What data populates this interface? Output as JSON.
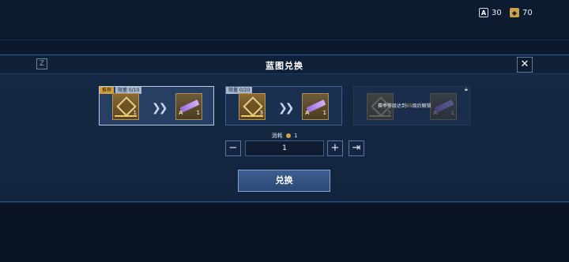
{
  "topbar": {
    "currency_a_value": "30",
    "currency_b_value": "70",
    "currency_a_icon": "a-token-icon",
    "currency_b_icon": "gold-crate-icon"
  },
  "modal": {
    "title": "蓝图兑换",
    "close_icon": "close-icon"
  },
  "options": [
    {
      "recommend_tag": "推荐",
      "limit_tag": "限量 0/10",
      "source_qty": "1",
      "target_grade": "A",
      "target_qty": "1"
    },
    {
      "limit_tag": "限量 0/20",
      "source_qty": "3",
      "target_grade": "A",
      "target_qty": "1"
    },
    {
      "source_qty": "5",
      "target_grade": "A",
      "target_qty": "1",
      "lock_prefix": "赛季等级达到",
      "lock_level": "65",
      "lock_suffix": "级后解锁"
    }
  ],
  "cost": {
    "label": "消耗",
    "value": "1"
  },
  "stepper": {
    "minus": "−",
    "value": "1",
    "plus": "+",
    "max": "⇥"
  },
  "redeem_button": "兑换",
  "accent": "#d5a13d"
}
